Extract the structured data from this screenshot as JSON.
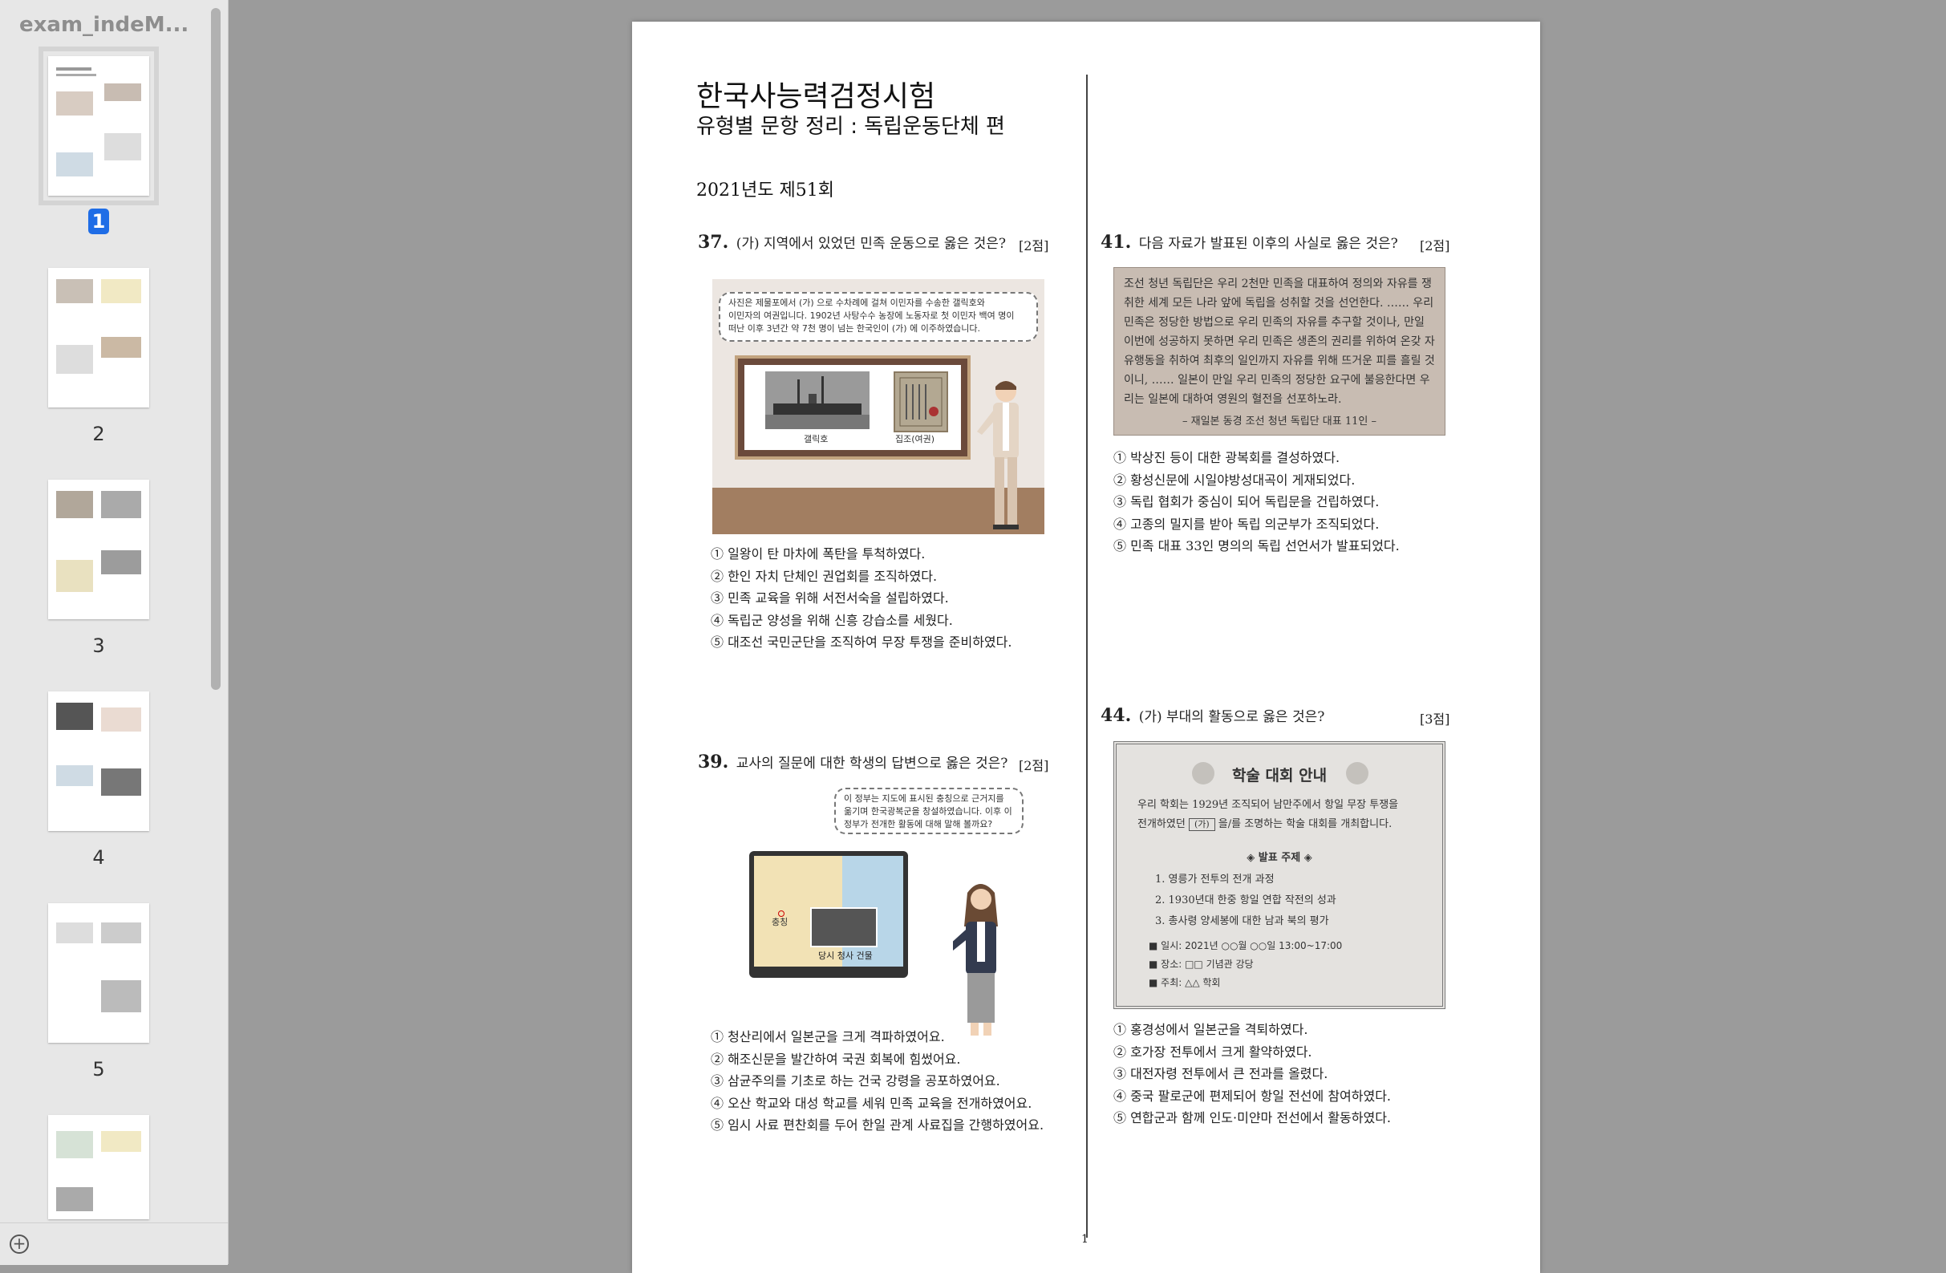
{
  "sidebar": {
    "title": "exam_indeM...",
    "pages": [
      "1",
      "2",
      "3",
      "4",
      "5"
    ]
  },
  "doc": {
    "title": "한국사능력검정시험",
    "subtitle": "유형별 문항 정리 : 독립운동단체 편",
    "year": "2021년도 제51회",
    "page_number": "1"
  },
  "q37": {
    "num": "37.",
    "question": "(가) 지역에서 있었던 민족 운동으로 옳은 것은?",
    "points": "[2점]",
    "bubble": [
      "사진은 제물포에서 (가) 으로 수차례에 걸쳐 이민자를 수송한 갤릭호와",
      "이민자의 여권입니다. 1902년 사탕수수 농장에 노동자로 첫 이민자 백여 명이",
      "떠난 이후 3년간 약 7천 명이 넘는 한국인이 (가) 에 이주하였습니다."
    ],
    "caption_ship": "갤릭호",
    "caption_passport": "집조(여권)",
    "choices": [
      "① 일왕이 탄 마차에 폭탄을 투척하였다.",
      "② 한인 자치 단체인 권업회를 조직하였다.",
      "③ 민족 교육을 위해 서전서숙을 설립하였다.",
      "④ 독립군 양성을 위해 신흥 강습소를 세웠다.",
      "⑤ 대조선 국민군단을 조직하여 무장 투쟁을 준비하였다."
    ]
  },
  "q41": {
    "num": "41.",
    "question": "다음 자료가 발표된 이후의 사실로 옳은 것은?",
    "points": "[2점]",
    "source": "조선 청년 독립단은 우리 2천만 민족을 대표하여 정의와 자유를 쟁취한 세계 모든 나라 앞에 독립을 성취할 것을 선언한다. …… 우리 민족은 정당한 방법으로 우리 민족의 자유를 추구할 것이나, 만일 이번에 성공하지 못하면 우리 민족은 생존의 권리를 위하여 온갖 자유행동을 취하여 최후의 일인까지 자유를 위해 뜨거운 피를 흘릴 것이니, …… 일본이 만일 우리 민족의 정당한 요구에 불응한다면 우리는 일본에 대하여 영원의 혈전을 선포하노라.",
    "cite": "– 재일본 동경 조선 청년 독립단 대표 11인 –",
    "choices": [
      "① 박상진 등이 대한 광복회를 결성하였다.",
      "② 황성신문에 시일야방성대곡이 게재되었다.",
      "③ 독립 협회가 중심이 되어 독립문을 건립하였다.",
      "④ 고종의 밀지를 받아 독립 의군부가 조직되었다.",
      "⑤ 민족 대표 33인 명의의 독립 선언서가 발표되었다."
    ]
  },
  "q39": {
    "num": "39.",
    "question": "교사의 질문에 대한 학생의 답변으로 옳은 것은?",
    "points": "[2점]",
    "bubble": [
      "이 정부는 지도에 표시된 충칭으로 근거지를",
      "옮기며 한국광복군을 창설하였습니다. 이후 이",
      "정부가 전개한 활동에 대해 말해 볼까요?"
    ],
    "map_label": "충칭",
    "photo_caption": "당시 청사 건물",
    "choices": [
      "① 청산리에서 일본군을 크게 격파하였어요.",
      "② 해조신문을 발간하여 국권 회복에 힘썼어요.",
      "③ 삼균주의를 기초로 하는 건국 강령을 공포하였어요.",
      "④ 오산 학교와 대성 학교를 세워 민족 교육을 전개하였어요.",
      "⑤ 임시 사료 편찬회를 두어 한일 관계 사료집을 간행하였어요."
    ]
  },
  "q44": {
    "num": "44.",
    "question": "(가) 부대의 활동으로 옳은 것은?",
    "points": "[3점]",
    "poster_title": "학술 대회 안내",
    "intro_1": "우리 학회는 1929년 조직되어 남만주에서 항일 무장 투쟁을",
    "intro_2a": "전개하였던",
    "blank": "(가)",
    "intro_2b": "을/를 조명하는 학술 대회를 개최합니다.",
    "topics_heading": "◈ 발표 주제 ◈",
    "topics": [
      "1. 영릉가 전투의 전개 과정",
      "2. 1930년대 한중 항일 연합 작전의 성과",
      "3. 총사령 양세봉에 대한 남과 북의 평가"
    ],
    "details": [
      "■ 일시: 2021년 ○○월 ○○일 13:00~17:00",
      "■ 장소: □□ 기념관 강당",
      "■ 주최: △△ 학회"
    ],
    "choices": [
      "① 홍경성에서 일본군을 격퇴하였다.",
      "② 호가장 전투에서 크게 활약하였다.",
      "③ 대전자령 전투에서 큰 전과를 올렸다.",
      "④ 중국 팔로군에 편제되어 항일 전선에 참여하였다.",
      "⑤ 연합군과 함께 인도·미얀마 전선에서 활동하였다."
    ]
  },
  "colors": {
    "accent": "#1f6de6",
    "sidebar_bg": "#e7e7e7",
    "viewer_bg": "#9b9b9b",
    "source_box": "#c8bcb2"
  }
}
